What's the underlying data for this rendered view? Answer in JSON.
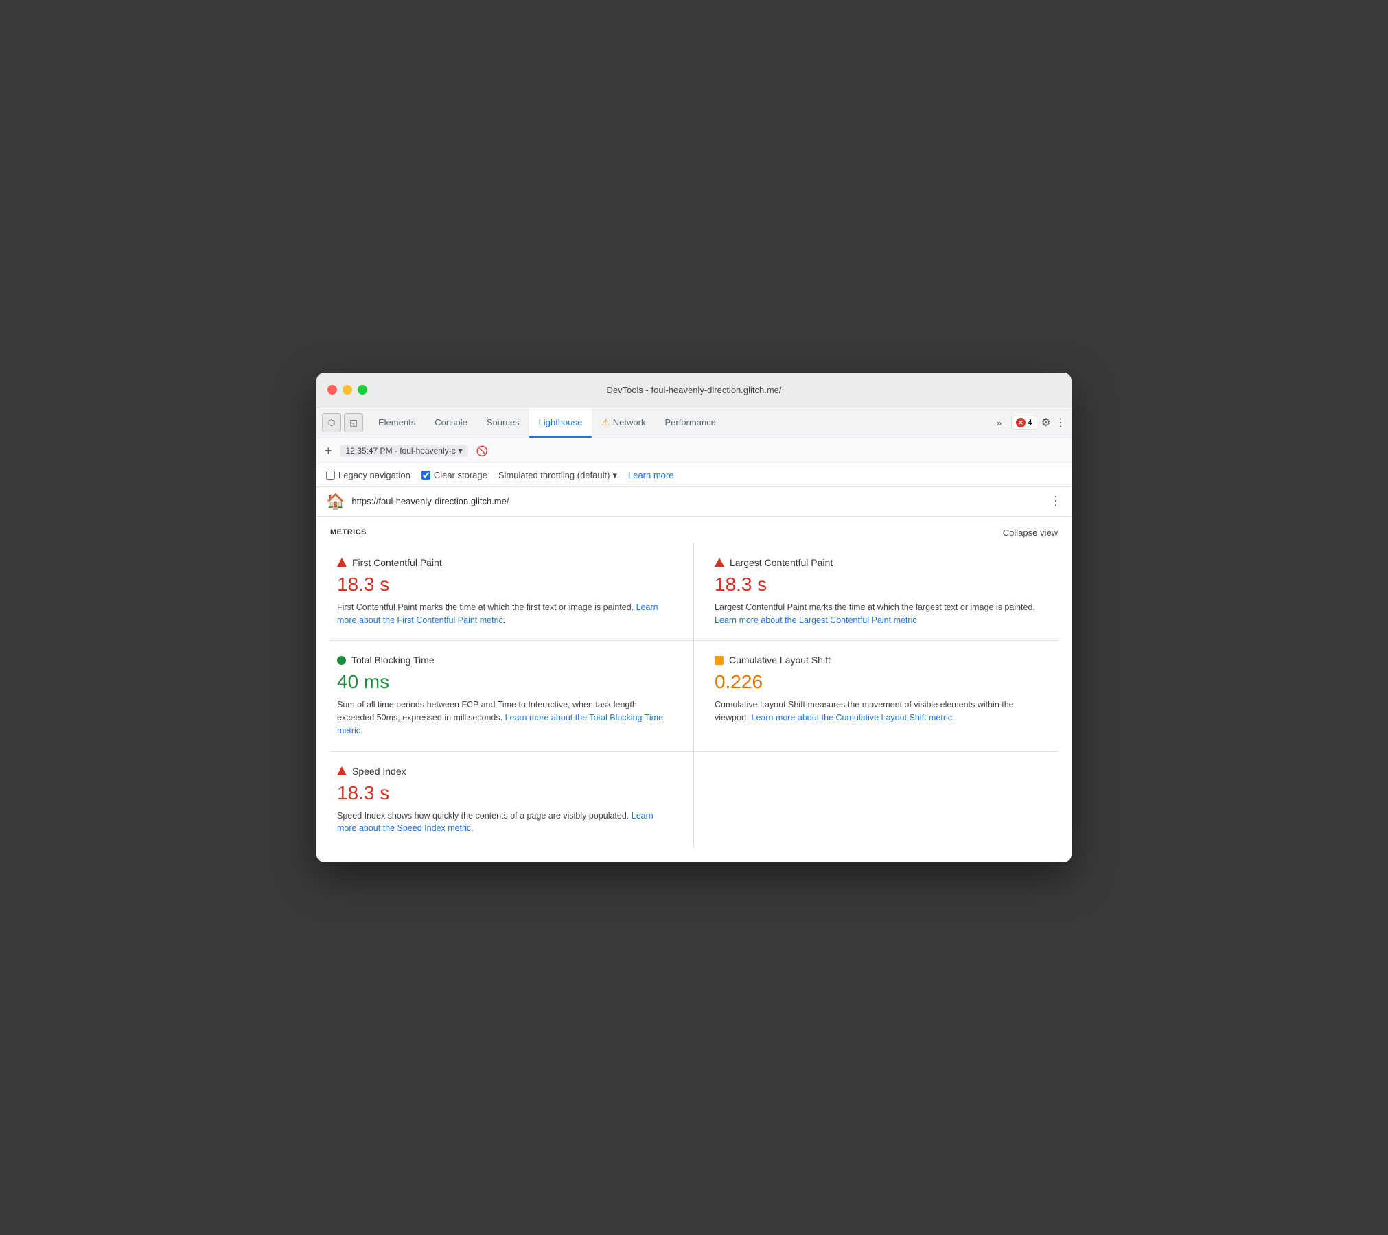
{
  "window": {
    "title": "DevTools - foul-heavenly-direction.glitch.me/"
  },
  "traffic_lights": {
    "red": "red traffic light",
    "yellow": "yellow traffic light",
    "green": "green traffic light"
  },
  "tabs": {
    "items": [
      {
        "id": "elements",
        "label": "Elements",
        "active": false
      },
      {
        "id": "console",
        "label": "Console",
        "active": false
      },
      {
        "id": "sources",
        "label": "Sources",
        "active": false
      },
      {
        "id": "lighthouse",
        "label": "Lighthouse",
        "active": true
      },
      {
        "id": "network",
        "label": "Network",
        "active": false,
        "warning": true
      },
      {
        "id": "performance",
        "label": "Performance",
        "active": false
      }
    ],
    "more_label": "»",
    "error_count": "4",
    "gear_icon": "⚙",
    "dots_icon": "⋮"
  },
  "sub_toolbar": {
    "add_label": "+",
    "timestamp": "12:35:47 PM - foul-heavenly-c",
    "block_icon": "🚫"
  },
  "options_bar": {
    "legacy_nav_label": "Legacy navigation",
    "clear_storage_label": "Clear storage",
    "throttling_label": "Simulated throttling (default)",
    "learn_more_label": "Learn more"
  },
  "url_bar": {
    "url": "https://foul-heavenly-direction.glitch.me/",
    "dots": "⋮"
  },
  "metrics": {
    "section_label": "METRICS",
    "collapse_label": "Collapse view",
    "items": [
      {
        "id": "fcp",
        "indicator": "red-triangle",
        "name": "First Contentful Paint",
        "value": "18.3 s",
        "value_color": "red",
        "description": "First Contentful Paint marks the time at which the first text or image is painted.",
        "link_text": "Learn more about the First Contentful Paint metric",
        "link_suffix": "."
      },
      {
        "id": "lcp",
        "indicator": "red-triangle",
        "name": "Largest Contentful Paint",
        "value": "18.3 s",
        "value_color": "red",
        "description": "Largest Contentful Paint marks the time at which the largest text or image is painted.",
        "link_text": "Learn more about the Largest Contentful Paint metric",
        "link_suffix": ""
      },
      {
        "id": "tbt",
        "indicator": "green-circle",
        "name": "Total Blocking Time",
        "value": "40 ms",
        "value_color": "green",
        "description": "Sum of all time periods between FCP and Time to Interactive, when task length exceeded 50ms, expressed in milliseconds.",
        "link_text": "Learn more about the Total Blocking Time metric",
        "link_suffix": "."
      },
      {
        "id": "cls",
        "indicator": "orange-square",
        "name": "Cumulative Layout Shift",
        "value": "0.226",
        "value_color": "orange",
        "description": "Cumulative Layout Shift measures the movement of visible elements within the viewport.",
        "link_text": "Learn more about the Cumulative Layout Shift metric",
        "link_suffix": "."
      },
      {
        "id": "si",
        "indicator": "red-triangle",
        "name": "Speed Index",
        "value": "18.3 s",
        "value_color": "red",
        "description": "Speed Index shows how quickly the contents of a page are visibly populated.",
        "link_text": "Learn more about the Speed Index metric",
        "link_suffix": "."
      }
    ]
  }
}
